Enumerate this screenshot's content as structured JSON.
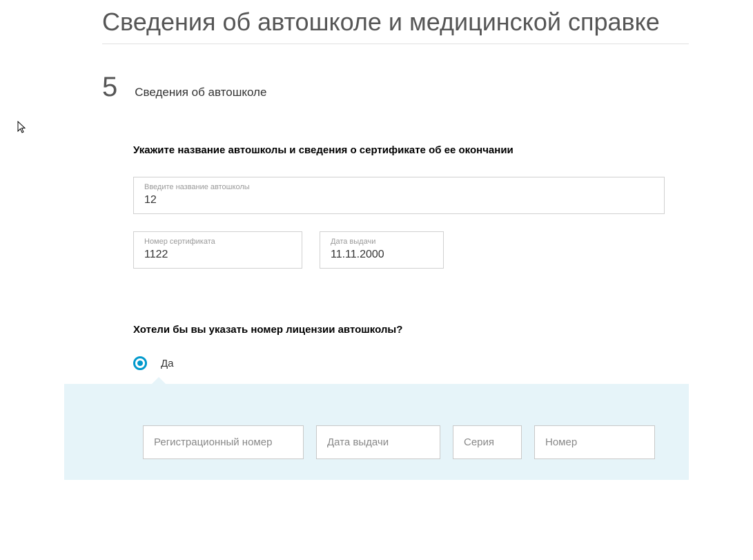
{
  "page": {
    "title": "Сведения об автошколе и медицинской справке"
  },
  "section5": {
    "number": "5",
    "title": "Сведения об автошколе",
    "subtitle": "Укажите название автошколы и сведения о сертификате об ее окончании",
    "school_name_label": "Введите название автошколы",
    "school_name_value": "12",
    "cert_number_label": "Номер сертификата",
    "cert_number_value": "1122",
    "cert_date_label": "Дата выдачи",
    "cert_date_value": "11.11.2000"
  },
  "license": {
    "question": "Хотели бы вы указать номер лицензии автошколы?",
    "yes_label": "Да",
    "selected": "yes",
    "reg_number_placeholder": "Регистрационный номер",
    "date_placeholder": "Дата выдачи",
    "series_placeholder": "Серия",
    "number_placeholder": "Номер"
  }
}
